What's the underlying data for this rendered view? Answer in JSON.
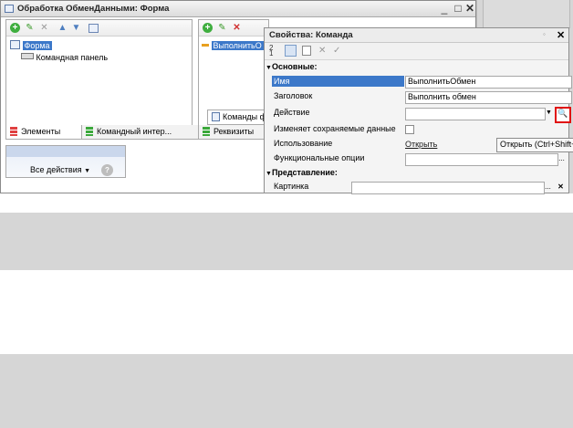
{
  "window": {
    "title": "Обработка ОбменДанными: Форма",
    "controls": [
      "_",
      "□",
      "✕"
    ]
  },
  "left_tree": {
    "items": [
      "Форма",
      "Командная панель"
    ]
  },
  "left_tabs": [
    "Элементы",
    "Командный интер..."
  ],
  "mid_pane": {
    "item": "ВыполнитьО",
    "sub_tab": "Команды ф",
    "tab": "Реквизиты"
  },
  "actions_panel": {
    "all_actions": "Все действия",
    "help": "?"
  },
  "properties": {
    "title": "Свойства: Команда",
    "close": "✕",
    "groups": {
      "basic": "Основные:",
      "view": "Представление:"
    },
    "rows": [
      {
        "label": "Имя",
        "value": "ВыполнитьОбмен"
      },
      {
        "label": "Заголовок",
        "value": "Выполнить обмен"
      },
      {
        "label": "Действие",
        "value": ""
      },
      {
        "label": "Изменяет сохраняемые данные",
        "value": ""
      },
      {
        "label": "Использование",
        "value": "Открыть"
      },
      {
        "label": "Функциональные опции",
        "value": ""
      },
      {
        "label": "Картинка",
        "value": ""
      }
    ],
    "tooltip": "Открыть (Ctrl+Shift+"
  },
  "colors": {
    "selection": "#3c78c9",
    "highlight_red": "#e01010",
    "gray_band": "#d6d6d6"
  }
}
